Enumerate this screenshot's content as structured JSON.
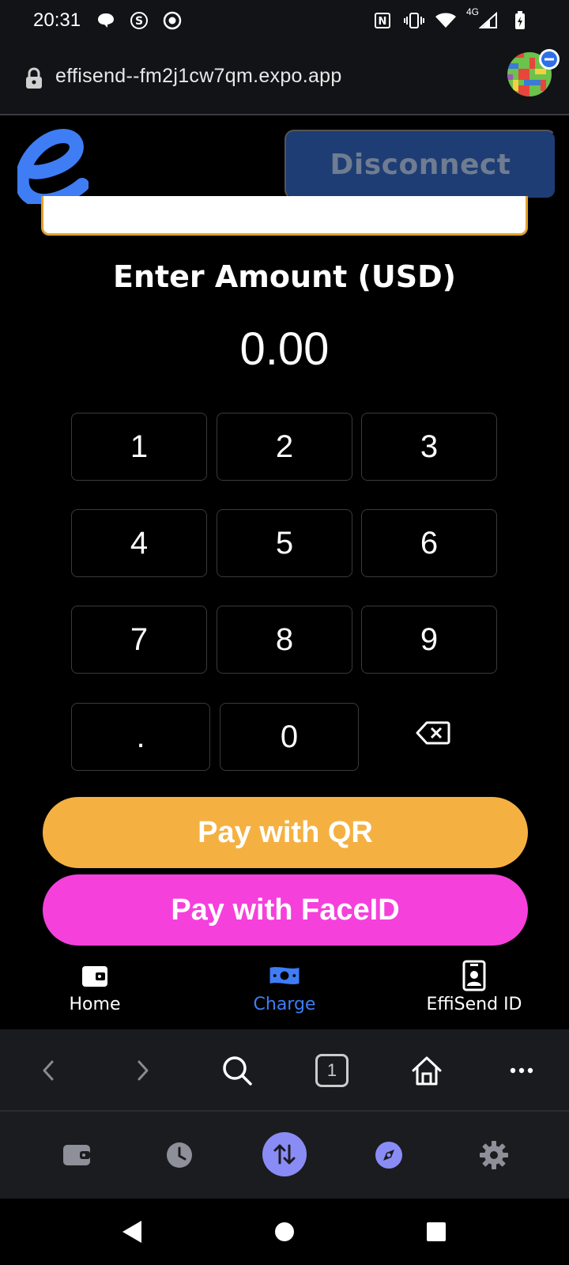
{
  "status_bar": {
    "time": "20:31",
    "network_label": "4G",
    "icons_left": [
      "chat-bubble-icon",
      "s-circle-icon",
      "record-icon"
    ],
    "icons_right": [
      "nfc-icon",
      "vibrate-icon",
      "wifi-icon",
      "signal-icon",
      "battery-icon"
    ]
  },
  "browser": {
    "url": "effisend--fm2j1cw7qm.expo.app",
    "tab_count": "1"
  },
  "header": {
    "disconnect_label": "Disconnect"
  },
  "amount": {
    "label": "Enter Amount (USD)",
    "value": "0.00"
  },
  "keypad": {
    "keys": [
      "1",
      "2",
      "3",
      "4",
      "5",
      "6",
      "7",
      "8",
      "9",
      ".",
      "0"
    ]
  },
  "actions": {
    "pay_qr": "Pay with QR",
    "pay_faceid": "Pay with FaceID"
  },
  "tabs": [
    {
      "label": "Home",
      "icon": "wallet-icon",
      "active": false
    },
    {
      "label": "Charge",
      "icon": "cash-icon",
      "active": true
    },
    {
      "label": "EffiSend ID",
      "icon": "id-card-icon",
      "active": false
    }
  ],
  "colors": {
    "accent_blue": "#3f7df5",
    "pay_qr": "#f4b142",
    "pay_faceid": "#f540dc",
    "disconnect_bg": "#1e3d74",
    "wallet_active": "#8a8cf6"
  }
}
